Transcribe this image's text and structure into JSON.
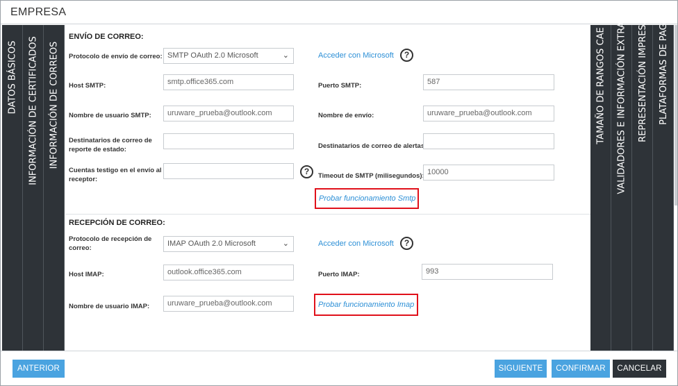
{
  "window": {
    "title": "EMPRESA"
  },
  "left_tabs": [
    "DATOS BÁSICOS",
    "INFORMACIÓN DE CERTIFICADOS",
    "INFORMACIÓN DE CORREOS"
  ],
  "right_tabs": [
    "TAMAÑO DE RANGOS CAE",
    "VALIDADORES E INFORMACIÓN EXTRA",
    "REPRESENTACIÓN IMPRESA",
    "PLATAFORMAS DE PAGO"
  ],
  "envio": {
    "title": "ENVÍO DE CORREO:",
    "protocol_label": "Protocolo de envío de correo:",
    "protocol_value": "SMTP OAuth 2.0 Microsoft",
    "ms_link": "Acceder con Microsoft",
    "host_label": "Host SMTP:",
    "host_value": "smtp.office365.com",
    "port_label": "Puerto SMTP:",
    "port_value": "587",
    "user_label": "Nombre de usuario SMTP:",
    "user_value": "uruware_prueba@outlook.com",
    "sender_label": "Nombre de envío:",
    "sender_value": "uruware_prueba@outlook.com",
    "status_label_1": "Destinatarios de correo de",
    "status_label_2": "reporte de estado:",
    "status_value": "",
    "alerts_label": "Destinatarios de correo de alertas:",
    "alerts_value": "",
    "witness_label_1": "Cuentas testigo en el envío al",
    "witness_label_2": "receptor:",
    "witness_value": "",
    "timeout_label": "Timeout de SMTP (milisegundos):",
    "timeout_value": "10000",
    "test_link": "Probar funcionamiento Smtp"
  },
  "recepcion": {
    "title": "RECEPCIÓN DE CORREO:",
    "protocol_label_1": "Protocolo de recepción de",
    "protocol_label_2": "correo:",
    "protocol_value": "IMAP OAuth 2.0 Microsoft",
    "ms_link": "Acceder con Microsoft",
    "host_label": "Host IMAP:",
    "host_value": "outlook.office365.com",
    "port_label": "Puerto IMAP:",
    "port_value": "993",
    "user_label": "Nombre de usuario IMAP:",
    "user_value": "uruware_prueba@outlook.com",
    "test_link": "Probar funcionamiento Imap"
  },
  "icons": {
    "help": "?",
    "chevron": "⌄"
  },
  "footer": {
    "prev": "ANTERIOR",
    "next": "SIGUIENTE",
    "confirm": "CONFIRMAR",
    "cancel": "CANCELAR"
  },
  "colors": {
    "accent": "#4aa3e0",
    "dark": "#2e3338",
    "link": "#2c8fd6",
    "highlight": "#e0101a"
  }
}
